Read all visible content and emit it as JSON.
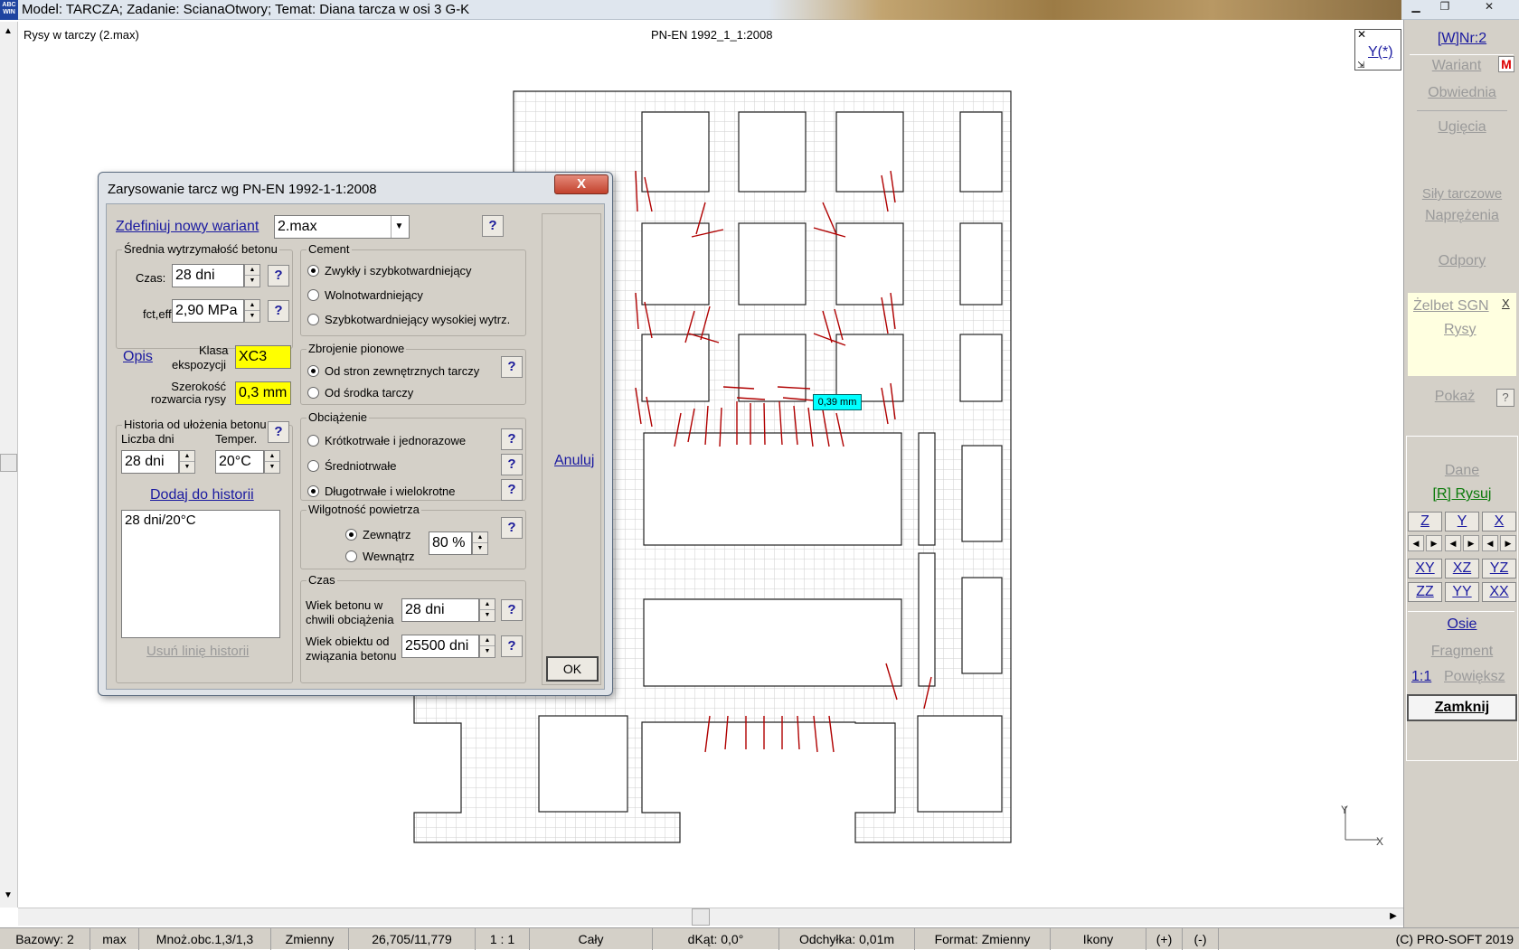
{
  "window": {
    "title": "Model: TARCZA;  Zadanie: ScianaOtwory;  Temat: Diana tarcza w osi 3 G-K",
    "logo": "ABC WINDOWS"
  },
  "drawing": {
    "view_title": "Rysy w tarczy (2.max)",
    "norm_label": "PN-EN 1992_1_1:2008",
    "axis_button": "Y(*)",
    "crack_label": "0,39 mm",
    "axis_y": "Y",
    "axis_x": "X"
  },
  "right_panel": {
    "variant_nr": "[W]Nr:2",
    "wariant": "Wariant",
    "m_badge": "M",
    "obwiednia": "Obwiednia",
    "ugiecia": "Ugięcia",
    "sily_tarczowe": "Siły tarczowe",
    "naprezenia": "Naprężenia",
    "odpory": "Odpory",
    "zelbet": "Żelbet SGN",
    "zelbet_close": "X",
    "rysy": "Rysy",
    "pokaz": "Pokaż",
    "pokaz_help": "?",
    "dane": "Dane",
    "rysuj": "[R] Rysuj",
    "views_row1": [
      "Z",
      "Y",
      "X"
    ],
    "views_row2": [
      "XY",
      "XZ",
      "YZ"
    ],
    "views_row3": [
      "ZZ",
      "YY",
      "XX"
    ],
    "osie": "Osie",
    "fragment": "Fragment",
    "scale_1_1": "1:1",
    "powieksz": "Powiększ",
    "zamknij": "Zamknij"
  },
  "status_bar": {
    "bazowy": "Bazowy: 2",
    "max": "max",
    "mnoz": "Mnoż.obc.1,3/1,3",
    "zmienny": "Zmienny",
    "coords": "26,705/11,779",
    "scale": "1 : 1",
    "caly": "Cały",
    "dkat": "dKąt: 0,0°",
    "odchylka": "Odchyłka: 0,01m",
    "format": "Format: Zmienny",
    "ikony": "Ikony",
    "plus": "(+)",
    "minus": "(-)",
    "copyright": "(C) PRO-SOFT 2019"
  },
  "dialog": {
    "title": "Zarysowanie tarcz wg PN-EN 1992-1-1:2008",
    "close": "X",
    "define_variant": "Zdefiniuj nowy wariant",
    "variant_value": "2.max",
    "help": "?",
    "strength_group": "Średnia wytrzymałość  betonu",
    "czas_label": "Czas:",
    "czas_value": "28 dni",
    "fct_label": "fct,eff",
    "fct_value": "2,90 MPa",
    "opis": "Opis",
    "klasa_label_1": "Klasa",
    "klasa_label_2": "ekspozycji",
    "klasa_value": "XC3",
    "szer_label_1": "Szerokość",
    "szer_label_2": "rozwarcia rysy",
    "szer_value": "0,3 mm",
    "history_group": "Historia od ułożenia betonu",
    "liczba_dni_label": "Liczba dni",
    "temper_label": "Temper.",
    "liczba_dni_value": "28 dni",
    "temper_value": "20°C",
    "dodaj": "Dodaj do historii",
    "history_items": [
      "28 dni/20°C"
    ],
    "usun": "Usuń linię historii",
    "cement_group": "Cement",
    "cement_options": [
      "Zwykły i szybkotwardniejący",
      "Wolnotwardniejący",
      "Szybkotwardniejący wysokiej wytrz."
    ],
    "zbrojenie_group": "Zbrojenie pionowe",
    "zbrojenie_options": [
      "Od stron zewnętrznych tarczy",
      "Od środka tarczy"
    ],
    "obciazenie_group": "Obciążenie",
    "obciazenie_options": [
      "Krótkotrwałe i jednorazowe",
      "Średniotrwałe",
      "Długotrwałe i wielokrotne"
    ],
    "wilgotnosc_group": "Wilgotność powietrza",
    "wilgotnosc_options": [
      "Zewnątrz",
      "Wewnątrz"
    ],
    "wilgotnosc_value": "80 %",
    "czas_group": "Czas",
    "wiek1_label_1": "Wiek betonu w",
    "wiek1_label_2": "chwili obciążenia",
    "wiek1_value": "28 dni",
    "wiek2_label_1": "Wiek obiektu od",
    "wiek2_label_2": "związania betonu",
    "wiek2_value": "25500 dni",
    "anuluj": "Anuluj",
    "ok": "OK"
  }
}
